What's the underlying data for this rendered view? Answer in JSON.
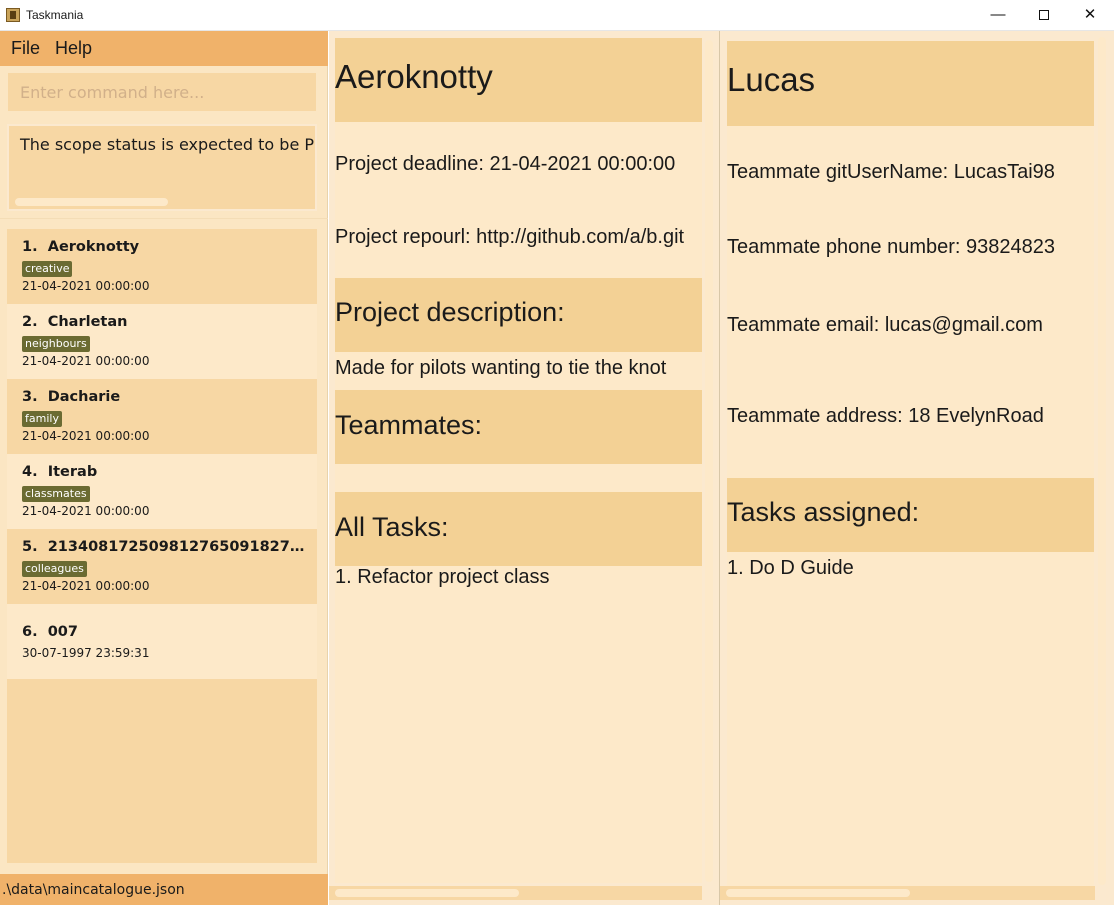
{
  "window": {
    "title": "Taskmania",
    "minimize_glyph": "—",
    "close_glyph": "✕"
  },
  "menu": {
    "file_label": "File",
    "help_label": "Help"
  },
  "command": {
    "placeholder": "Enter command here...",
    "value": ""
  },
  "result": {
    "text": "The scope status is expected to be PERSON"
  },
  "projects": [
    {
      "index": "1.",
      "name": "Aeroknotty",
      "tag": "creative",
      "deadline": "21-04-2021 00:00:00"
    },
    {
      "index": "2.",
      "name": "Charletan",
      "tag": "neighbours",
      "deadline": "21-04-2021 00:00:00"
    },
    {
      "index": "3.",
      "name": "Dacharie",
      "tag": "family",
      "deadline": "21-04-2021 00:00:00"
    },
    {
      "index": "4.",
      "name": "Iterab",
      "tag": "classmates",
      "deadline": "21-04-2021 00:00:00"
    },
    {
      "index": "5.",
      "name": "2134081725098127650918274098237...",
      "tag": "colleagues",
      "deadline": "21-04-2021 00:00:00"
    },
    {
      "index": "6.",
      "name": "007",
      "tag": "",
      "deadline": "30-07-1997 23:59:31"
    }
  ],
  "status_bar": {
    "path": ".\\data\\maincatalogue.json"
  },
  "project_detail": {
    "name": "Aeroknotty",
    "deadline": "Project deadline: 21-04-2021 00:00:00",
    "repourl": "Project repourl: http://github.com/a/b.git",
    "description_heading": "Project description:",
    "description": "Made for pilots wanting to tie the knot",
    "teammates_heading": "Teammates:",
    "tasks_heading": "All Tasks:",
    "tasks": [
      "1. Refactor project class"
    ]
  },
  "teammate_detail": {
    "name": "Lucas",
    "git": "Teammate gitUserName: LucasTai98",
    "phone": "Teammate phone number: 93824823",
    "email": "Teammate email: lucas@gmail.com",
    "address": "Teammate address: 18 EvelynRoad",
    "tasks_heading": "Tasks assigned:",
    "tasks": [
      "1. Do D Guide"
    ]
  }
}
